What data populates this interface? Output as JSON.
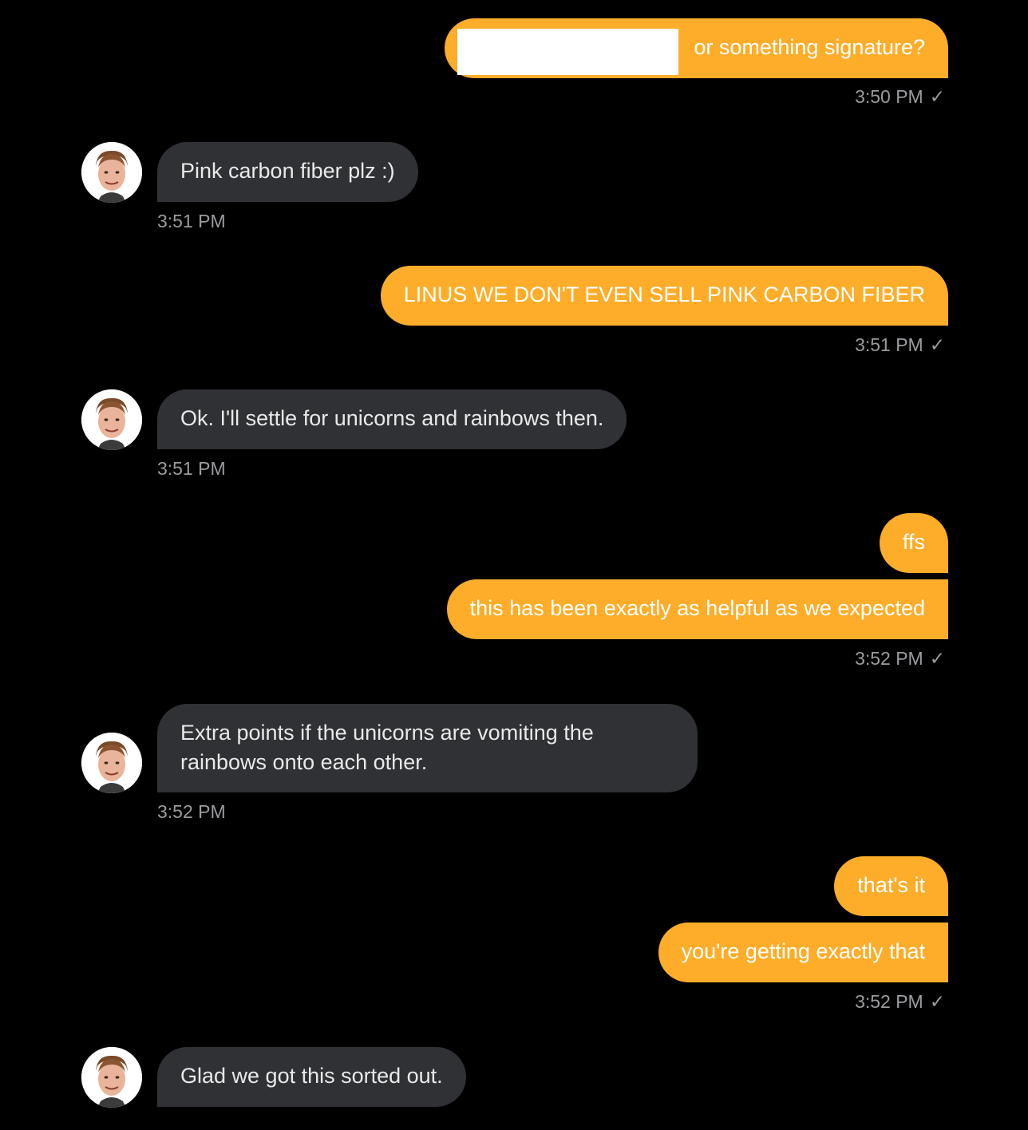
{
  "colors": {
    "background": "#000000",
    "outgoing_bubble": "#FDAD29",
    "incoming_bubble": "#2F3135",
    "timestamp": "#9b9ca0"
  },
  "icons": {
    "read_receipt": "checkmark-icon",
    "contact_avatar": "avatar-photo"
  },
  "messages": [
    {
      "direction": "outgoing",
      "text": "or something signature?",
      "redacted_prefix": true
    },
    {
      "direction": "outgoing_timestamp",
      "time": "3:50 PM",
      "check": "✓"
    },
    {
      "direction": "incoming",
      "text": "Pink carbon fiber plz :)"
    },
    {
      "direction": "incoming_timestamp",
      "time": "3:51 PM"
    },
    {
      "direction": "outgoing",
      "text": "LINUS WE DON'T EVEN SELL PINK CARBON FIBER"
    },
    {
      "direction": "outgoing_timestamp",
      "time": "3:51 PM",
      "check": "✓"
    },
    {
      "direction": "incoming",
      "text": "Ok. I'll settle for unicorns and rainbows then."
    },
    {
      "direction": "incoming_timestamp",
      "time": "3:51 PM"
    },
    {
      "direction": "outgoing",
      "text": "ffs"
    },
    {
      "direction": "outgoing",
      "text": "this has been exactly as helpful as we expected"
    },
    {
      "direction": "outgoing_timestamp",
      "time": "3:52 PM",
      "check": "✓"
    },
    {
      "direction": "incoming",
      "text_line1": "Extra points if the unicorns are vomiting the",
      "text_line2": "rainbows onto each other."
    },
    {
      "direction": "incoming_timestamp",
      "time": "3:52 PM"
    },
    {
      "direction": "outgoing",
      "text": "that's it"
    },
    {
      "direction": "outgoing",
      "text": "you're getting exactly that"
    },
    {
      "direction": "outgoing_timestamp",
      "time": "3:52 PM",
      "check": "✓"
    },
    {
      "direction": "incoming",
      "text": "Glad we got this sorted out."
    }
  ]
}
